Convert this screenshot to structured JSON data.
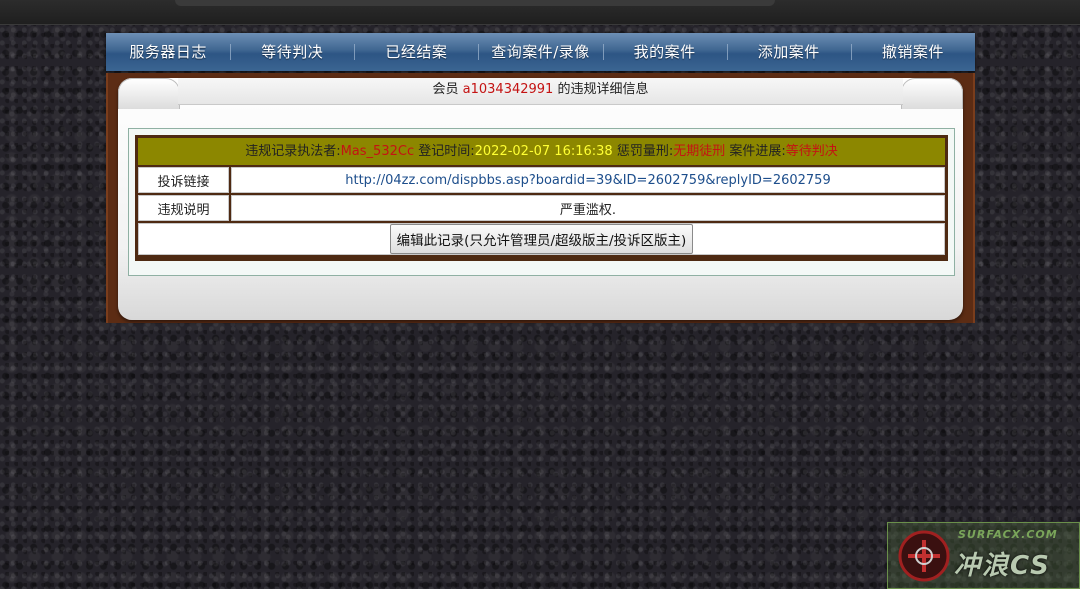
{
  "nav": {
    "items": [
      "服务器日志",
      "等待判决",
      "已经结案",
      "查询案件/录像",
      "我的案件",
      "添加案件",
      "撤销案件"
    ]
  },
  "panel": {
    "title_prefix": "会员",
    "member_id": "a1034342991",
    "title_suffix": "的违规详细信息"
  },
  "record": {
    "executor_label": "违规记录执法者:",
    "executor": "Mas_532Cc",
    "time_label": "登记时间:",
    "time": "2022-02-07 16:16:38",
    "penalty_label": "惩罚量刑:",
    "penalty": "无期徒刑",
    "progress_label": "案件进展:",
    "progress": "等待判决",
    "complaint_link_label": "投诉链接",
    "complaint_link": "http://04zz.com/dispbbs.asp?boardid=39&ID=2602759&replyID=2602759",
    "violation_label": "违规说明",
    "violation_desc": "严重滥权.",
    "edit_button": "编辑此记录(只允许管理员/超级版主/投诉区版主)"
  },
  "watermark": {
    "url": "SURFACX.COM",
    "name": "冲浪CS"
  },
  "colors": {
    "nav_blue": "#3f6691",
    "header_olive": "#8c8700",
    "frame_brown": "#5c2c14",
    "highlight_red": "#c41313",
    "highlight_yellow": "#ffff33"
  }
}
